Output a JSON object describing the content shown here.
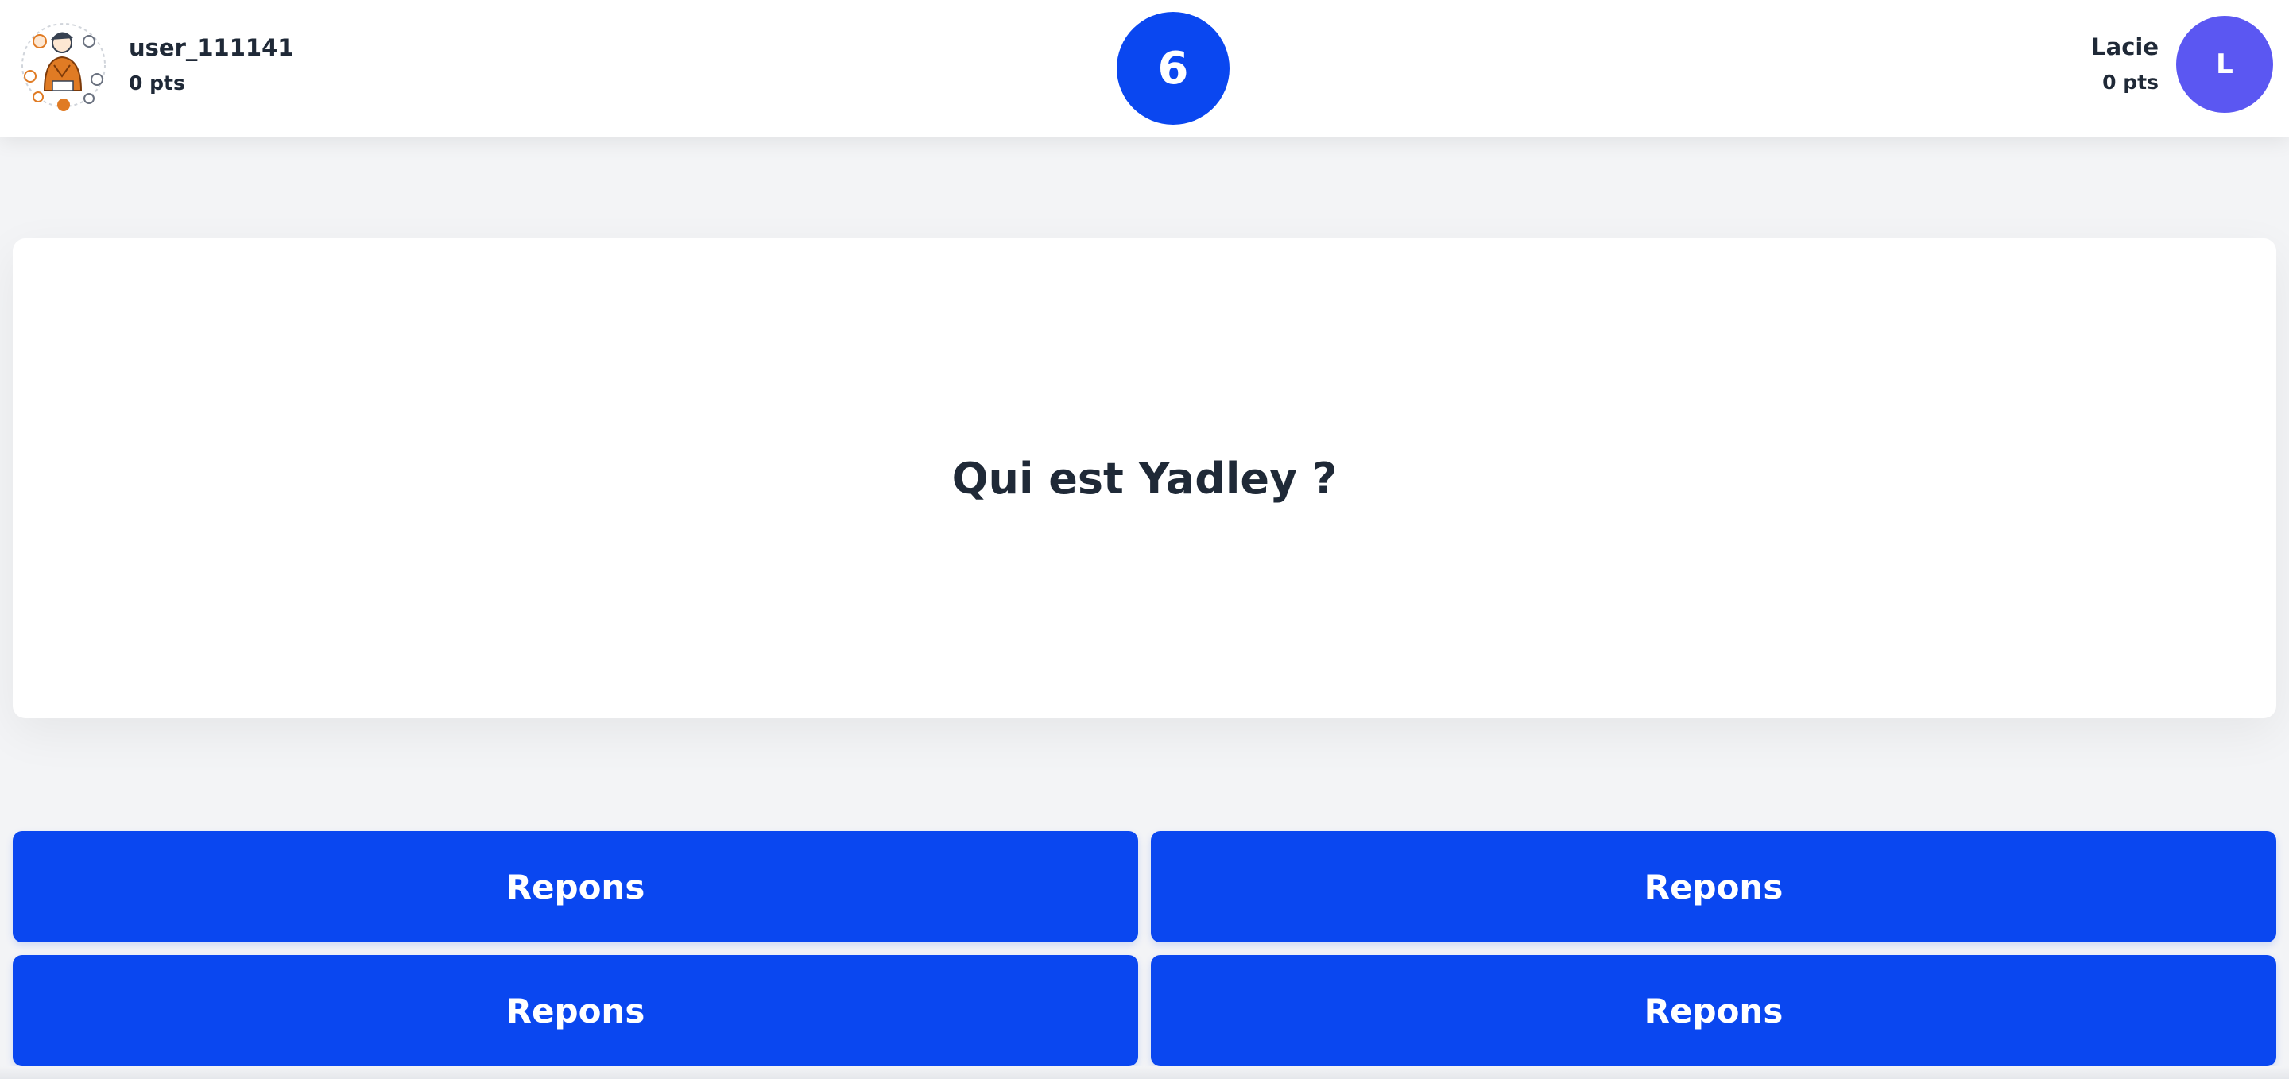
{
  "header": {
    "player_left": {
      "name": "user_111141",
      "score": "0 pts",
      "avatar_icon": "illustrated-person-avatar"
    },
    "timer": {
      "value": "6",
      "color": "#0a47f0"
    },
    "player_right": {
      "name": "Lacie",
      "score": "0 pts",
      "avatar_letter": "L",
      "avatar_color": "#5b57f2"
    }
  },
  "question": {
    "text": "Qui est Yadley ?"
  },
  "answers": [
    {
      "label": "Repons"
    },
    {
      "label": "Repons"
    },
    {
      "label": "Repons"
    },
    {
      "label": "Repons"
    }
  ],
  "colors": {
    "accent": "#0a47f0",
    "background": "#f3f4f6",
    "card": "#ffffff",
    "text": "#1f2937"
  }
}
